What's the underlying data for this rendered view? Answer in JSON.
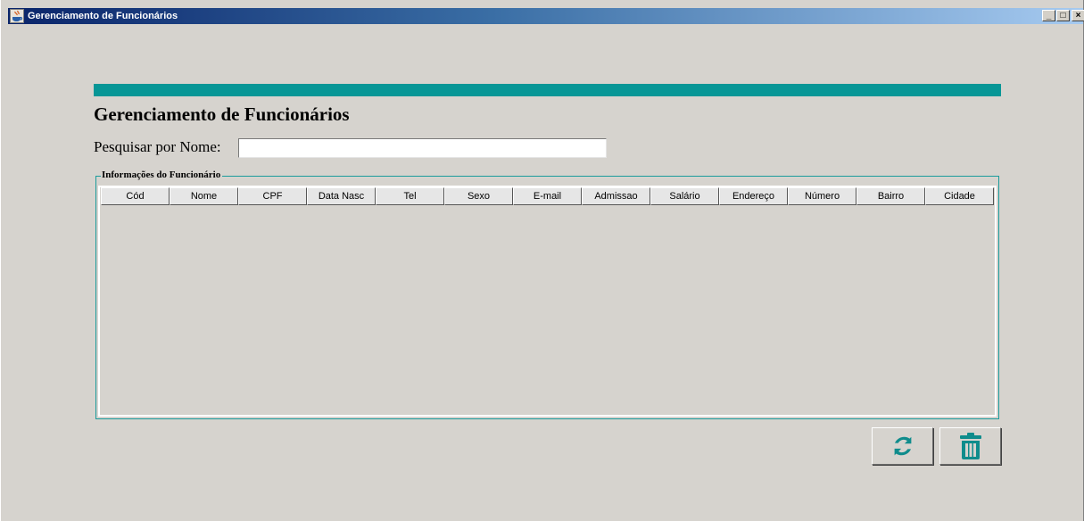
{
  "window": {
    "title": "Gerenciamento de Funcionários",
    "controls": {
      "minimize": "_",
      "maximize": "□",
      "close": "×"
    }
  },
  "colors": {
    "accent": "#079696",
    "background": "#d6d3ce",
    "titlebar_start": "#0a246a",
    "titlebar_end": "#a6caf0"
  },
  "page": {
    "title": "Gerenciamento de Funcionários",
    "search_label": "Pesquisar por Nome:",
    "search_value": "",
    "search_placeholder": ""
  },
  "group": {
    "legend": "Informações do Funcionário"
  },
  "table": {
    "columns": [
      "Cód",
      "Nome",
      "CPF",
      "Data Nasc",
      "Tel",
      "Sexo",
      "E-mail",
      "Admissao",
      "Salário",
      "Endereço",
      "Número",
      "Bairro",
      "Cidade"
    ],
    "rows": []
  },
  "actions": {
    "refresh_icon": "refresh-icon",
    "delete_icon": "trash-icon"
  }
}
